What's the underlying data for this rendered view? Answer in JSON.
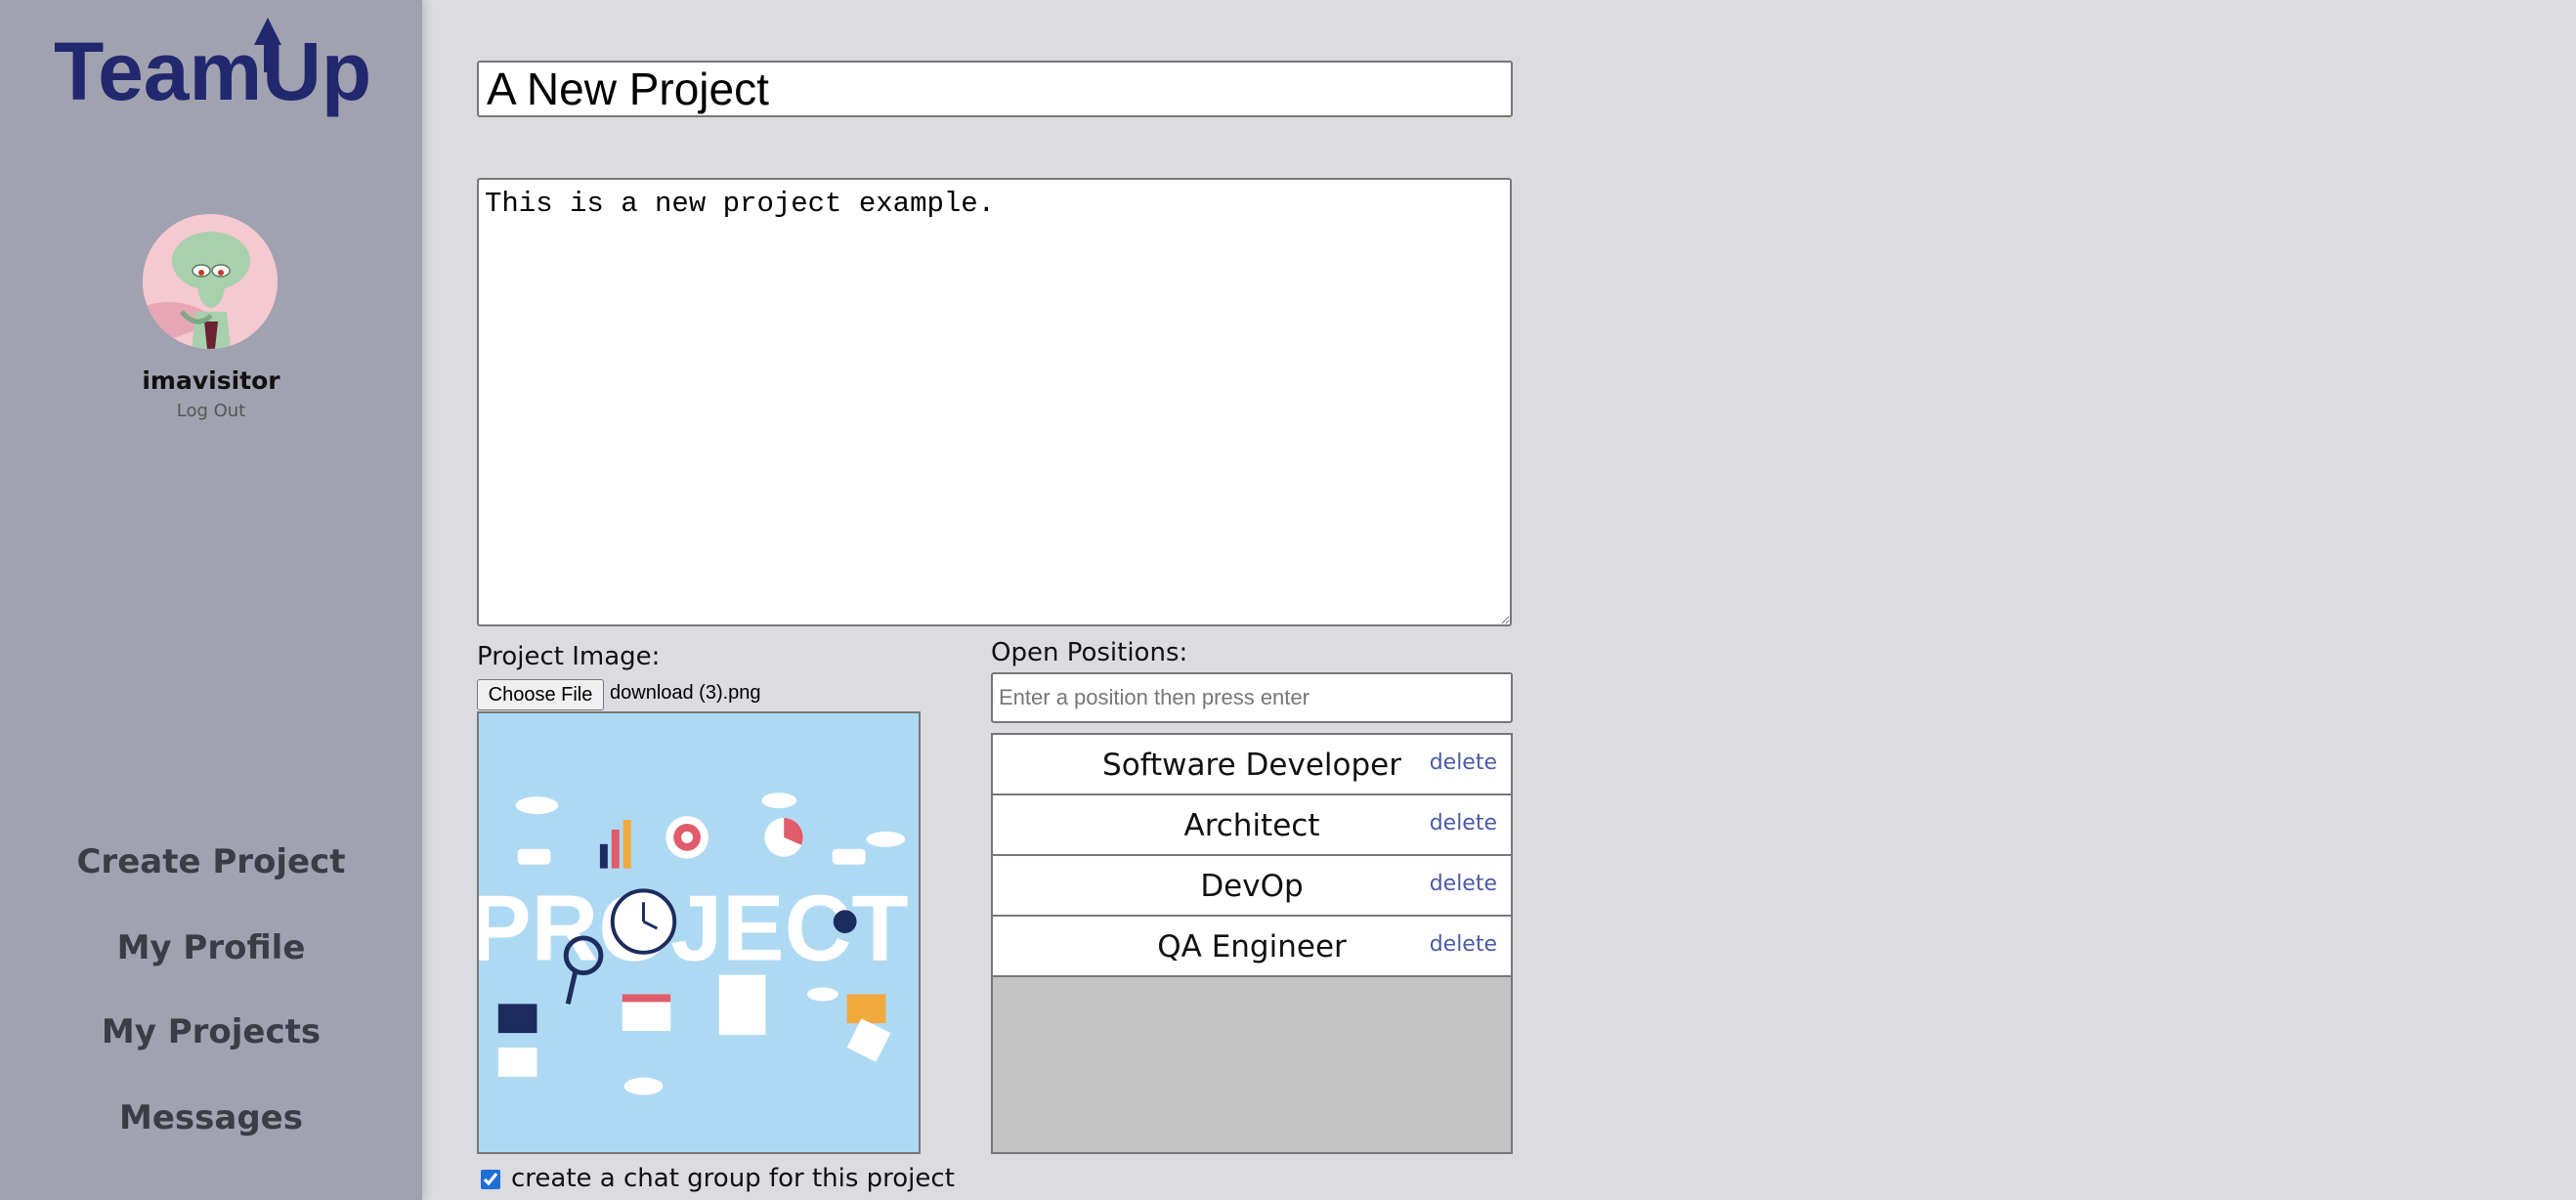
{
  "app": {
    "logo_text": "TeamUp",
    "accent_color": "#22286e"
  },
  "sidebar": {
    "username": "imavisitor",
    "logout": "Log Out",
    "nav": [
      {
        "label": "Create Project"
      },
      {
        "label": "My Profile"
      },
      {
        "label": "My Projects"
      },
      {
        "label": "Messages"
      }
    ]
  },
  "form": {
    "title_value": "A New Project",
    "description_value": "This is a new project example.",
    "image_label": "Project Image:",
    "choose_file_label": "Choose File",
    "file_name": "download (3).png",
    "positions_label": "Open Positions:",
    "position_placeholder": "Enter a position then press enter",
    "positions": [
      {
        "name": "Software Developer",
        "delete": "delete"
      },
      {
        "name": "Architect",
        "delete": "delete"
      },
      {
        "name": "DevOp",
        "delete": "delete"
      },
      {
        "name": "QA Engineer",
        "delete": "delete"
      }
    ],
    "chat_group_label": "create a chat group for this project",
    "chat_group_checked": true
  },
  "preview_image": {
    "word": "PROJECT",
    "background": "#aed9f3"
  }
}
